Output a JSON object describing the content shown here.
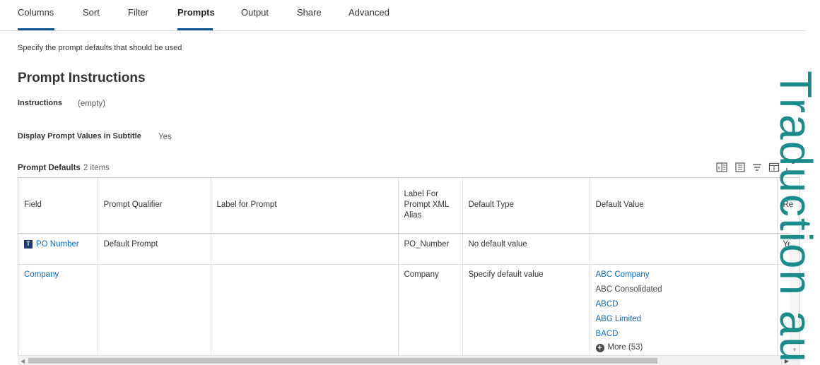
{
  "tabs": [
    {
      "label": "Columns",
      "active": false
    },
    {
      "label": "Sort",
      "active": false
    },
    {
      "label": "Filter",
      "active": false
    },
    {
      "label": "Prompts",
      "active": true
    },
    {
      "label": "Output",
      "active": false
    },
    {
      "label": "Share",
      "active": false
    },
    {
      "label": "Advanced",
      "active": false
    }
  ],
  "page": {
    "subtitle": "Specify the prompt defaults that should be used",
    "section_title": "Prompt Instructions",
    "instructions_label": "Instructions",
    "instructions_value": "(empty)",
    "display_label": "Display Prompt Values in Subtitle",
    "display_value": "Yes"
  },
  "grid": {
    "title": "Prompt Defaults",
    "count": "2 items",
    "toolbar_icons": [
      "export-excel-icon",
      "column-chooser-icon",
      "filter-icon",
      "split-view-icon",
      "expand-icon"
    ],
    "columns": [
      "Field",
      "Prompt Qualifier",
      "Label for Prompt",
      "Label For Prompt XML Alias",
      "Default Type",
      "Default Value",
      "Re"
    ],
    "rows": [
      {
        "field": "PO Number",
        "field_badge": "T",
        "prompt_qualifier": "Default Prompt",
        "label_for_prompt": "",
        "xml_alias": "PO_Number",
        "default_type": "No default value",
        "default_value": [],
        "re": "Ye"
      },
      {
        "field": "Company",
        "prompt_qualifier": "",
        "label_for_prompt": "",
        "xml_alias": "Company",
        "default_type": "Specify default value",
        "default_value": [
          {
            "text": "ABC Company",
            "link": true
          },
          {
            "text": "ABC Consolidated",
            "link": false
          },
          {
            "text": "ABCD",
            "link": true
          },
          {
            "text": "ABG Limited",
            "link": true
          },
          {
            "text": "BACD",
            "link": true
          }
        ],
        "more": "More (53)",
        "re": ""
      }
    ]
  },
  "watermark": "Traduction au",
  "colors": {
    "accent": "#0b5393",
    "link": "#0b69c4",
    "watermark": "#1a8c8c"
  }
}
